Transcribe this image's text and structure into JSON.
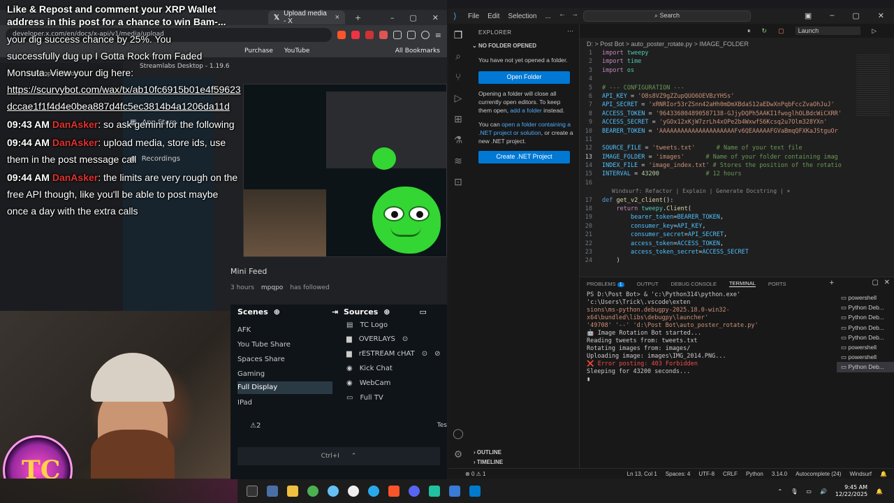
{
  "browser": {
    "tab_label": "Upload media - X",
    "url": "developer.x.com/en/docs/x-api/v1/media/upload",
    "bookmarks": [
      "Purchase",
      "YouTube",
      "All Bookmarks"
    ],
    "streamlabs_title": "Streamlabs Desktop - 1.19.6",
    "dev_platform": "Developer Platform",
    "app_store": "App Store",
    "recordings": "Recordings"
  },
  "chat": {
    "top_line_1": "Like & Repost and comment your XRP Wallet",
    "top_line_2": "address in this post for a chance to win Bam-...",
    "lines": [
      "your dig success chance by 25%. You",
      "successfully dug up I Gotta Rock from Faded",
      "Monsuta. View your dig here:"
    ],
    "link": "https://scurvybot.com/wax/tx/ab10fc6915b01e4f59623dccae1f1f4d4e0bea887d4fc5ec3814b4a1206da11d",
    "messages": [
      {
        "time": "09:43 AM",
        "user": "DanAsker",
        "text": ": so ask gemini for the following"
      },
      {
        "time": "09:44 AM",
        "user": "DanAsker",
        "text": ": upload media, store ids, use them in the post message call"
      },
      {
        "time": "09:44 AM",
        "user": "DanAsker",
        "text": ": the limits are very rough on the free API though, like you'll be able to post maybe once a day with the extra calls"
      }
    ]
  },
  "mini_feed": {
    "title": "Mini Feed",
    "time": "3 hours",
    "user": "mpqpo",
    "action": "has followed"
  },
  "obs": {
    "scenes_title": "Scenes",
    "sources_title": "Sources",
    "scenes": [
      "AFK",
      "You Tube Share",
      "Spaces Share",
      "Gaming",
      "Full Display",
      "IPad"
    ],
    "selected_scene": "Full Display",
    "sources": [
      "TC Logo",
      "OVERLAYS",
      "rESTREAM cHAT",
      "Kick Chat",
      "WebCam",
      "Full TV"
    ],
    "notif_count": "2",
    "shortcut": "Ctrl+I",
    "test_label": "Tes"
  },
  "vscode": {
    "menu": [
      "File",
      "Edit",
      "Selection",
      "..."
    ],
    "search": "Search",
    "explorer_title": "EXPLORER",
    "no_folder_title": "NO FOLDER OPENED",
    "no_folder_msg": "You have not yet opened a folder.",
    "open_folder_btn": "Open Folder",
    "close_editors_msg_1": "Opening a folder will close all currently open editors. To keep them open,",
    "add_folder_link": "add a folder",
    "close_editors_msg_2": "instead.",
    "dotnet_msg_1": "You can",
    "dotnet_link": "open a folder containing a .NET project or solution",
    "dotnet_msg_2": ", or create a new .NET project.",
    "create_dotnet_btn": "Create .NET Project",
    "outline": "OUTLINE",
    "timeline": "TIMELINE",
    "launch": "Launch",
    "breadcrumb": "D: > Post Bot > auto_poster_rotate.py > IMAGE_FOLDER",
    "codelens": "Windsurf: Refactor | Explain | Generate Docstring | ×",
    "code": [
      {
        "n": "1",
        "html": "<span class='kw'>import</span> <span class='mod'>tweepy</span>"
      },
      {
        "n": "2",
        "html": "<span class='kw'>import</span> <span class='mod'>time</span>"
      },
      {
        "n": "3",
        "html": "<span class='kw'>import</span> <span class='mod'>os</span>"
      },
      {
        "n": "4",
        "html": ""
      },
      {
        "n": "5",
        "html": "<span class='cm'># --- CONFIGURATION ---</span>"
      },
      {
        "n": "6",
        "html": "<span class='var'>API_KEY</span> = <span class='str'>'O8s8VZ9gZZupQUO6OEVBzYHSs'</span>"
      },
      {
        "n": "7",
        "html": "<span class='var'>API_SECRET</span> = <span class='str'>'xRNRIor53rZSnn42aHh0mDmXBdaS12aEDwXnPqbFccZvaOhJuJ'</span>"
      },
      {
        "n": "8",
        "html": "<span class='var'>ACCESS_TOKEN</span> = <span class='str'>'964336804890587138-GJjyDQPh5AAKI1fwoglhOLBdcWiCXRR'</span>"
      },
      {
        "n": "9",
        "html": "<span class='var'>ACCESS_SECRET</span> = <span class='str'>'yGOx12xKjW7zrLh4xOPe2b4WxwfS6Kcsq2u7Olm328YXn'</span>"
      },
      {
        "n": "10",
        "html": "<span class='var'>BEARER_TOKEN</span> = <span class='str'>'AAAAAAAAAAAAAAAAAAAAAFv6QEAAAAAFGVaBmqQFXKaJStguOr</span>"
      },
      {
        "n": "11",
        "html": ""
      },
      {
        "n": "12",
        "html": "<span class='var'>SOURCE_FILE</span> = <span class='str'>'tweets.txt'</span>      <span class='cm'># Name of your text file</span>"
      },
      {
        "n": "13",
        "html": "<span class='var'>IMAGE_FOLDER</span> = <span class='str'>'images'</span>      <span class='cm'># Name of your folder containing imag</span>"
      },
      {
        "n": "14",
        "html": "<span class='var'>INDEX_FILE</span> = <span class='str'>'image_index.txt'</span> <span class='cm'># Stores the position of the rotatio</span>"
      },
      {
        "n": "15",
        "html": "<span class='var'>INTERVAL</span> = <span class='num'>43200</span>             <span class='cm'># 12 hours</span>"
      },
      {
        "n": "16",
        "html": ""
      },
      {
        "n": "17",
        "html": "<span class='kw2'>def</span> <span class='fn'>get_v2_client</span>():"
      },
      {
        "n": "18",
        "html": "    <span class='kw'>return</span> <span class='mod'>tweepy</span>.<span class='fn'>Client</span>("
      },
      {
        "n": "19",
        "html": "        <span class='var'>bearer_token</span>=<span class='var'>BEARER_TOKEN</span>,"
      },
      {
        "n": "20",
        "html": "        <span class='var'>consumer_key</span>=<span class='var'>API_KEY</span>,"
      },
      {
        "n": "21",
        "html": "        <span class='var'>consumer_secret</span>=<span class='var'>API_SECRET</span>,"
      },
      {
        "n": "22",
        "html": "        <span class='var'>access_token</span>=<span class='var'>ACCESS_TOKEN</span>,"
      },
      {
        "n": "23",
        "html": "        <span class='var'>access_token_secret</span>=<span class='var'>ACCESS_SECRET</span>"
      },
      {
        "n": "24",
        "html": "    )"
      }
    ],
    "current_line": "13",
    "panel_tabs": [
      "PROBLEMS",
      "OUTPUT",
      "DEBUG CONSOLE",
      "TERMINAL",
      "PORTS"
    ],
    "problems_count": "1",
    "terminal": [
      {
        "cls": "",
        "text": "PS D:\\Post Bot> & 'c:\\Python314\\python.exe' 'c:\\Users\\Trick\\.vscode\\exten"
      },
      {
        "cls": "path",
        "text": "  sions\\ms-python.debugpy-2025.18.0-win32-x64\\bundled\\libs\\debugpy\\launcher'"
      },
      {
        "cls": "path",
        "text": "  '49708' '--' 'd:\\Post Bot\\auto_poster_rotate.py'"
      },
      {
        "cls": "",
        "text": "🤖 Image Rotation Bot started..."
      },
      {
        "cls": "",
        "text": "Reading tweets from: tweets.txt"
      },
      {
        "cls": "",
        "text": "Rotating images from: images/"
      },
      {
        "cls": "",
        "text": "Uploading image: images\\IMG_2014.PNG..."
      },
      {
        "cls": "red",
        "text": "❌ Error posting: 403 Forbidden"
      },
      {
        "cls": "",
        "text": "Sleeping for 43200 seconds..."
      }
    ],
    "terminal_list": [
      "powershell",
      "Python Deb...",
      "Python Deb...",
      "Python Deb...",
      "Python Deb...",
      "powershell",
      "powershell",
      "Python Deb..."
    ],
    "terminal_list_selected": 7,
    "status": {
      "errors": "0",
      "warnings": "1",
      "position": "Ln 13, Col 1",
      "spaces": "Spaces: 4",
      "encoding": "UTF-8",
      "eol": "CRLF",
      "language": "Python",
      "version": "3.14.0",
      "autocomplete": "Autocomplete (24)",
      "windsurf": "Windsurf"
    }
  },
  "taskbar": {
    "time": "9:45 AM",
    "date": "12/22/2025"
  },
  "logo_text": "TC"
}
